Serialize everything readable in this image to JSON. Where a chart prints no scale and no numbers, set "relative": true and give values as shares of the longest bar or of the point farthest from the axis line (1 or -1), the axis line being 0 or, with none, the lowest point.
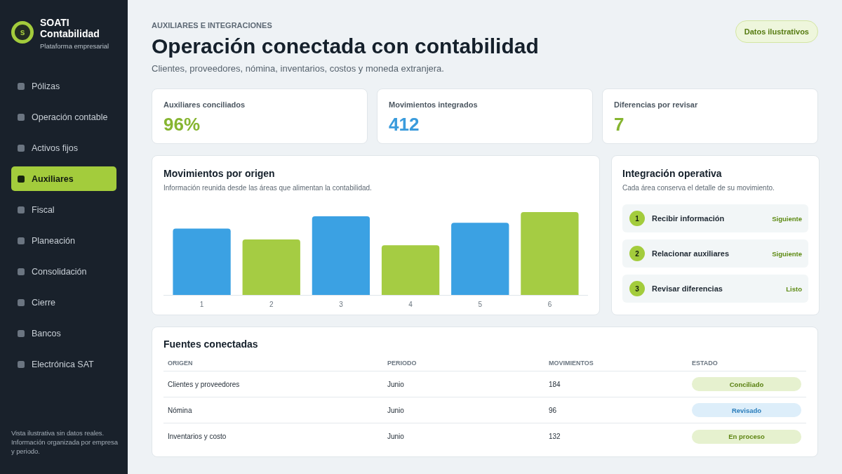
{
  "sidebar": {
    "brand": {
      "logo_letter": "s",
      "title": "SOATI Contabilidad",
      "subtitle": "Plataforma empresarial"
    },
    "items": [
      {
        "label": "Pólizas",
        "selected": false
      },
      {
        "label": "Operación contable",
        "selected": false
      },
      {
        "label": "Activos fijos",
        "selected": false
      },
      {
        "label": "Auxiliares",
        "selected": true
      },
      {
        "label": "Fiscal",
        "selected": false
      },
      {
        "label": "Planeación",
        "selected": false
      },
      {
        "label": "Consolidación",
        "selected": false
      },
      {
        "label": "Cierre",
        "selected": false
      },
      {
        "label": "Bancos",
        "selected": false
      },
      {
        "label": "Electrónica SAT",
        "selected": false
      }
    ],
    "footer": "Vista ilustrativa sin datos reales. Información organizada por empresa y periodo."
  },
  "header": {
    "eyebrow": "AUXILIARES E INTEGRACIONES",
    "title": "Operación conectada con contabilidad",
    "subtitle": "Clientes, proveedores, nómina, inventarios, costos y moneda extranjera.",
    "badge": "Datos ilustrativos"
  },
  "kpis": [
    {
      "label": "Auxiliares conciliados",
      "value": "96%",
      "color": "#86b530"
    },
    {
      "label": "Movimientos integrados",
      "value": "412",
      "color": "#3a9bdc"
    },
    {
      "label": "Diferencias por revisar",
      "value": "7",
      "color": "#86b530"
    }
  ],
  "chart_card": {
    "title": "Movimientos por origen",
    "subtitle": "Información reunida desde las áreas que alimentan la contabilidad.",
    "chart_data": {
      "type": "bar",
      "relative": true,
      "categories": [
        "1",
        "2",
        "3",
        "4",
        "5",
        "6"
      ],
      "values": [
        0.8,
        0.67,
        0.95,
        0.6,
        0.87,
        1.0
      ],
      "colors": [
        "#3ba1e3",
        "#a5cc43",
        "#3ba1e3",
        "#a5cc43",
        "#3ba1e3",
        "#a5cc43"
      ]
    }
  },
  "integration": {
    "title": "Integración operativa",
    "subtitle": "Cada área conserva el detalle de su movimiento.",
    "steps": [
      {
        "number": "1",
        "label": "Recibir información",
        "status": "Siguiente"
      },
      {
        "number": "2",
        "label": "Relacionar auxiliares",
        "status": "Siguiente"
      },
      {
        "number": "3",
        "label": "Revisar diferencias",
        "status": "Listo"
      }
    ]
  },
  "sources": {
    "title": "Fuentes conectadas",
    "columns": [
      "ORIGEN",
      "PERIODO",
      "MOVIMIENTOS",
      "ESTADO"
    ],
    "rows": [
      {
        "cells": [
          "Clientes y proveedores",
          "Junio",
          "184"
        ],
        "status": {
          "label": "Conciliado",
          "kind": "success"
        }
      },
      {
        "cells": [
          "Nómina",
          "Junio",
          "96"
        ],
        "status": {
          "label": "Revisado",
          "kind": "info"
        }
      },
      {
        "cells": [
          "Inventarios y costo",
          "Junio",
          "132"
        ],
        "status": {
          "label": "En proceso",
          "kind": "progress"
        }
      }
    ]
  }
}
